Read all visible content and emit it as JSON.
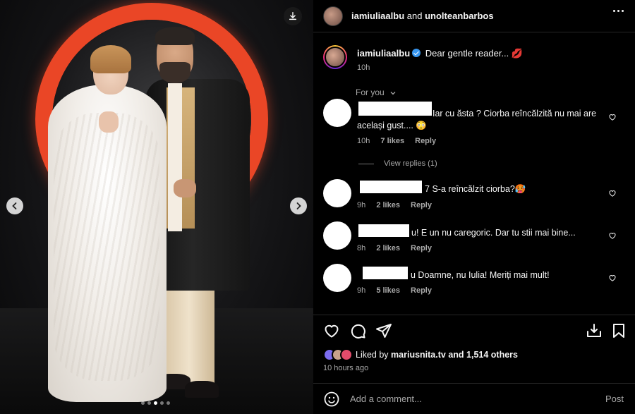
{
  "post": {
    "header": {
      "user1": "iamiuliaalbu",
      "and_text": "and",
      "user2": "unolteanbarbos"
    },
    "caption": {
      "username": "iamiuliaalbu",
      "text": "Dear gentle reader...",
      "emoji": "💋",
      "time": "10h"
    },
    "comments_sort": "For you",
    "comments": [
      {
        "text_line1": "Iar cu ăsta ? Ciorba reîncălzită nu mai are",
        "text_line2": "același gust.... 😳",
        "time": "10h",
        "likes": "7 likes",
        "reply": "Reply"
      },
      {
        "prefix": "7",
        "text": "S-a reîncălzit ciorba?🥵",
        "time": "9h",
        "likes": "2 likes",
        "reply": "Reply"
      },
      {
        "text": "u! E un nu caregoric. Dar tu stii mai bine...",
        "time": "8h",
        "likes": "2 likes",
        "reply": "Reply"
      },
      {
        "text": "u Doamne, nu Iulia! Meriți mai mult!",
        "time": "9h",
        "likes": "5 likes",
        "reply": "Reply"
      }
    ],
    "view_replies": "View replies (1)",
    "liked_by": {
      "prefix": "Liked by",
      "user": "mariusnita.tv",
      "rest": "and 1,514 others"
    },
    "posted_ago": "10 hours ago",
    "comment_box": {
      "placeholder": "Add a comment...",
      "post_label": "Post"
    }
  },
  "carousel": {
    "current": 3,
    "total": 5
  },
  "colors": {
    "ring": "#ea4626",
    "verified": "#3897f0",
    "background": "#000000"
  }
}
